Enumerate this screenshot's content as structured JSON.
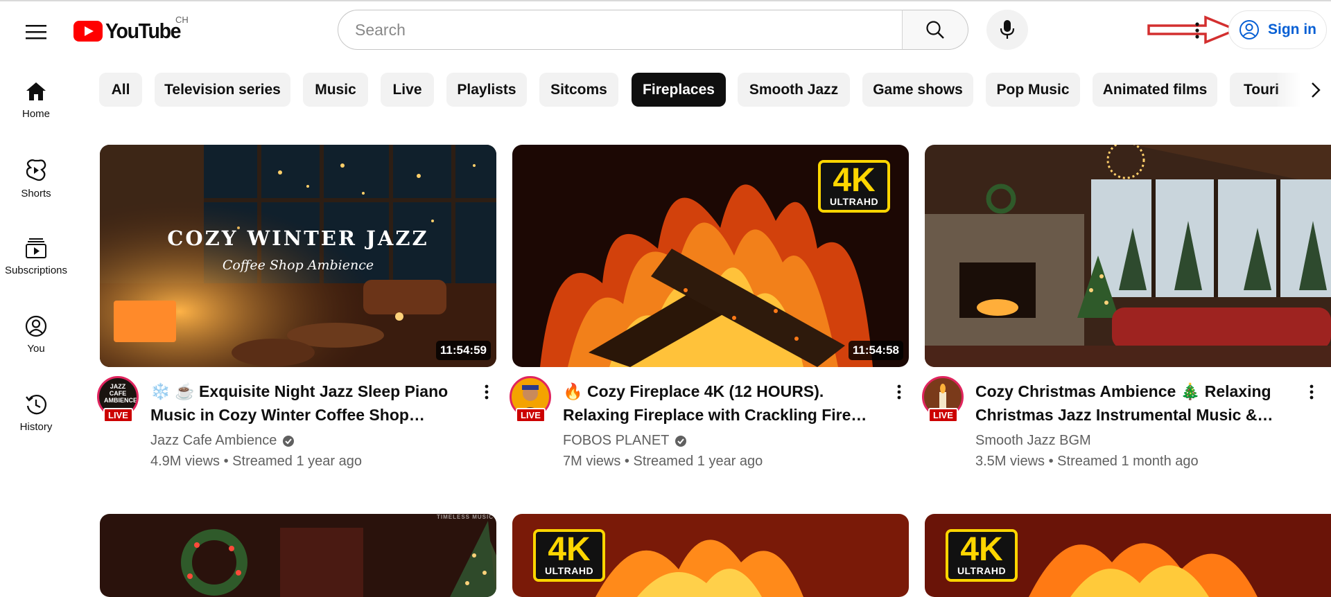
{
  "header": {
    "logo_text": "YouTube",
    "country_code": "CH",
    "search_placeholder": "Search",
    "sign_in_label": "Sign in",
    "icons": [
      "menu-icon",
      "youtube-logo-icon",
      "search-icon",
      "microphone-icon",
      "more-vert-icon",
      "account-circle-icon"
    ]
  },
  "sidebar": {
    "items": [
      {
        "label": "Home",
        "icon": "home-icon"
      },
      {
        "label": "Shorts",
        "icon": "shorts-icon"
      },
      {
        "label": "Subscriptions",
        "icon": "subscriptions-icon"
      },
      {
        "label": "You",
        "icon": "you-icon"
      },
      {
        "label": "History",
        "icon": "history-icon"
      }
    ]
  },
  "chips": {
    "items": [
      "All",
      "Television series",
      "Music",
      "Live",
      "Playlists",
      "Sitcoms",
      "Fireplaces",
      "Smooth Jazz",
      "Game shows",
      "Pop Music",
      "Animated films",
      "Touri"
    ],
    "active": "Fireplaces"
  },
  "videos": [
    {
      "title_line1": "❄️ ☕ Exquisite Night Jazz Sleep Piano",
      "title_line2": "Music in Cozy Winter Coffee Shop…",
      "channel": "Jazz Cafe Ambience",
      "views": "4.9M views",
      "age": "Streamed 1 year ago",
      "duration": "11:54:59",
      "thumb_text1": "COZY WINTER JAZZ",
      "thumb_text2": "Coffee Shop Ambience",
      "avatar_text": "JAZZ CAFE AMBIENCE",
      "live_label": "LIVE"
    },
    {
      "title_line1": "🔥 Cozy Fireplace 4K (12 HOURS).",
      "title_line2": "Relaxing Fireplace with Crackling Fire…",
      "channel": "FOBOS PLANET",
      "views": "7M views",
      "age": "Streamed 1 year ago",
      "duration": "11:54:58",
      "badge_big": "4K",
      "badge_small": "ULTRAHD",
      "live_label": "LIVE"
    },
    {
      "title_line1": "Cozy Christmas Ambience 🎄 Relaxing",
      "title_line2": "Christmas Jazz Instrumental Music &…",
      "channel": "Smooth Jazz BGM",
      "views": "3.5M views",
      "age": "Streamed 1 month ago",
      "live_label": "LIVE"
    }
  ],
  "row2": {
    "thumb1_watermark": "TIMELESS MUSIC",
    "badge_big": "4K",
    "badge_small": "ULTRAHD"
  },
  "meta_separator": "•",
  "colors": {
    "brand_red": "#ff0000",
    "link_blue": "#065fd4",
    "live_red": "#cc0000",
    "annotation_arrow": "#d32f2f"
  }
}
